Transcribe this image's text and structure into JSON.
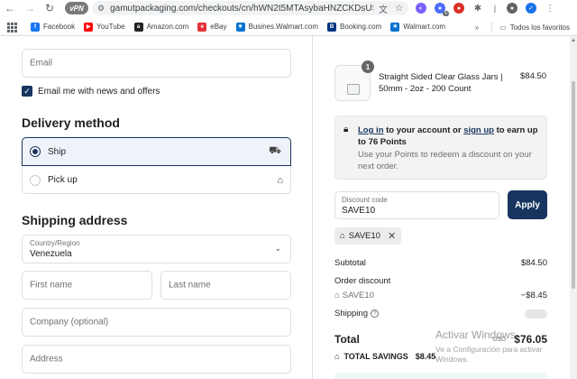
{
  "browser": {
    "ext_label": "vPN",
    "url": "gamutpackaging.com/checkouts/cn/hWN2t5MTAsybaHNZCKDsUSyw/e...",
    "toolbar_badge": "5",
    "bookmarks": [
      {
        "label": "Facebook",
        "icon": "facebook-icon",
        "color": "#1877f2",
        "glyph": "f"
      },
      {
        "label": "YouTube",
        "icon": "youtube-icon",
        "color": "#ff0000",
        "glyph": "▶"
      },
      {
        "label": "Amazon.com",
        "icon": "amazon-icon",
        "color": "#222222",
        "glyph": "a"
      },
      {
        "label": "eBay",
        "icon": "ebay-icon",
        "color": "#e53238",
        "glyph": "e"
      },
      {
        "label": "Busines.Walmart.com",
        "icon": "walmart-icon",
        "color": "#0071ce",
        "glyph": "✳"
      },
      {
        "label": "Booking.com",
        "icon": "booking-icon",
        "color": "#003580",
        "glyph": "B"
      },
      {
        "label": "Walmart.com",
        "icon": "walmart-icon",
        "color": "#0071ce",
        "glyph": "✳"
      }
    ],
    "favorites_label": "Todos los favoritos"
  },
  "contact": {
    "email_placeholder": "Email",
    "newsletter_label": "Email me with news and offers",
    "newsletter_checked": true
  },
  "delivery": {
    "heading": "Delivery method",
    "options": [
      {
        "label": "Ship",
        "selected": true
      },
      {
        "label": "Pick up",
        "selected": false
      }
    ]
  },
  "shipping": {
    "heading": "Shipping address",
    "country_label": "Country/Region",
    "country_value": "Venezuela",
    "first_name_placeholder": "First name",
    "last_name_placeholder": "Last name",
    "company_placeholder": "Company (optional)",
    "address_placeholder": "Address"
  },
  "order": {
    "product": {
      "quantity": "1",
      "name": "Straight Sided Clear Glass Jars | 50mm - 2oz - 200 Count",
      "price": "$84.50"
    },
    "login": {
      "login_link": "Log in",
      "mid_text": " to your account or ",
      "signup_link": "sign up",
      "end_text": " to earn up to 76 Points",
      "sub_text": "Use your Points to redeem a discount on your next order."
    },
    "discount": {
      "label": "Discount code",
      "value": "SAVE10",
      "apply_label": "Apply",
      "chip_label": "SAVE10"
    },
    "summary": {
      "subtotal_label": "Subtotal",
      "subtotal_value": "$84.50",
      "order_discount_label": "Order discount",
      "code_label": "SAVE10",
      "code_value": "−$8.45",
      "shipping_label": "Shipping",
      "total_label": "Total",
      "currency": "USD",
      "total_value": "$76.05",
      "savings_label": "TOTAL SAVINGS",
      "savings_value": "$8.45"
    }
  },
  "watermark": {
    "line1": "Activar Windows",
    "line2": "Ve a Configuración para activar Windows."
  },
  "colors": {
    "accent": "#17355f",
    "muted": "#707070",
    "border": "#dedede"
  }
}
